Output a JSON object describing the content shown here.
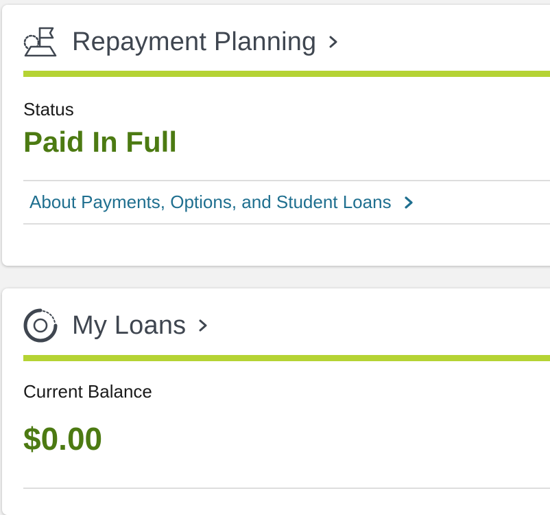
{
  "repayment_card": {
    "icon": "flag-map-icon",
    "title": "Repayment Planning",
    "status_label": "Status",
    "status_value": "Paid In Full",
    "link_text": "About Payments, Options, and Student Loans"
  },
  "loans_card": {
    "icon": "pie-chart-icon",
    "title": "My Loans",
    "balance_label": "Current Balance",
    "balance_value": "$0.00"
  },
  "colors": {
    "accent_rule": "#b5d334",
    "value_green": "#4c7a12",
    "link_blue": "#1f6f8f",
    "header_gray": "#3f4650"
  }
}
